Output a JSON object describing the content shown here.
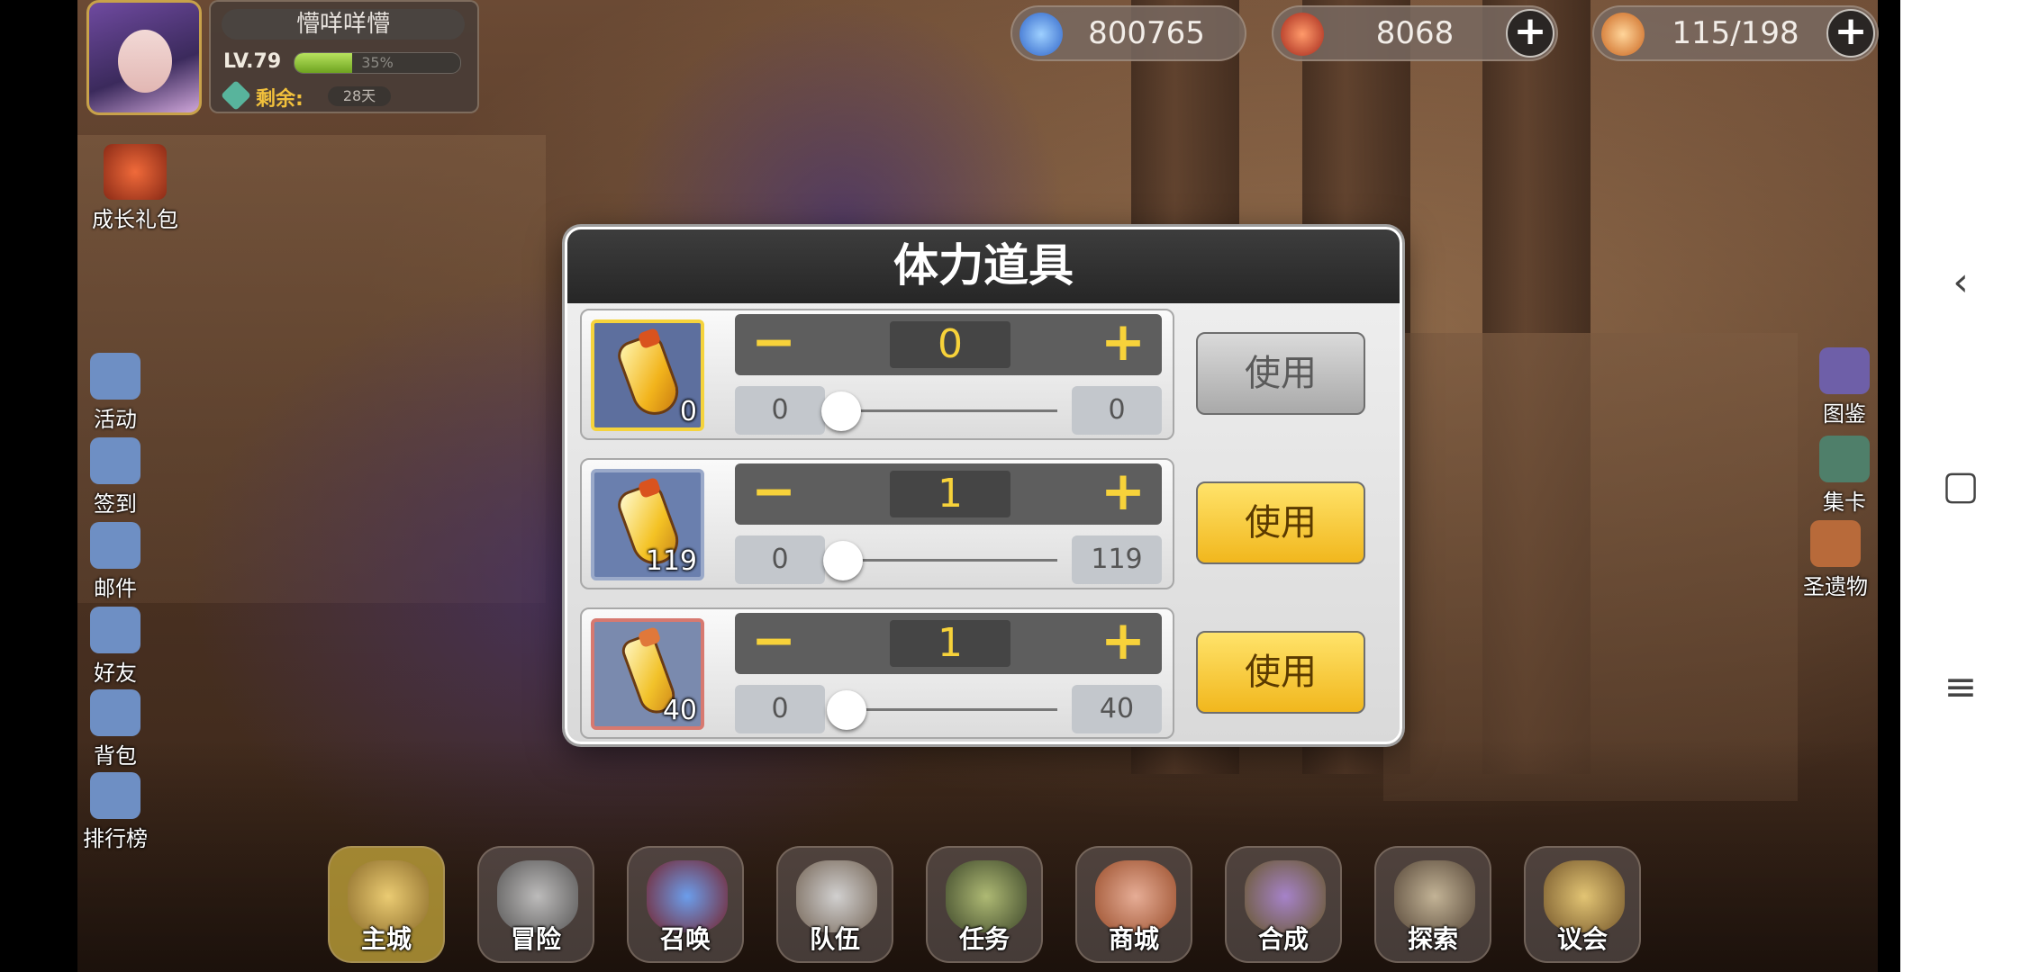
{
  "player": {
    "name": "懵咩咩懵",
    "level_label": "LV.79",
    "xp_percent_text": "35%",
    "xp_fraction": 0.35,
    "remaining_label": "剩余:",
    "remaining_days": "28天"
  },
  "currencies": [
    {
      "name": "crystal",
      "value": "800765",
      "has_plus": false,
      "color": "#3f7fe0"
    },
    {
      "name": "gem",
      "value": "8068",
      "has_plus": true,
      "color": "#c8442c"
    },
    {
      "name": "stamina",
      "value": "115/198",
      "has_plus": true,
      "color": "#d2782c"
    }
  ],
  "left_menu": {
    "gift_pack": "成长礼包",
    "items": [
      "活动",
      "签到",
      "邮件",
      "好友",
      "背包",
      "排行榜"
    ]
  },
  "right_menu": [
    "图鉴",
    "集卡",
    "圣遗物"
  ],
  "bottom_nav": [
    "主城",
    "冒险",
    "召唤",
    "队伍",
    "任务",
    "商城",
    "合成",
    "探索",
    "议会"
  ],
  "dialog": {
    "title": "体力道具",
    "rows": [
      {
        "count": "0",
        "value": "0",
        "min": "0",
        "max": "0",
        "slider_fraction": 0.0,
        "button": "使用",
        "enabled": false,
        "frame": "gold"
      },
      {
        "count": "119",
        "value": "1",
        "min": "0",
        "max": "119",
        "slider_fraction": 0.0084,
        "button": "使用",
        "enabled": true,
        "frame": "blue"
      },
      {
        "count": "40",
        "value": "1",
        "min": "0",
        "max": "40",
        "slider_fraction": 0.025,
        "button": "使用",
        "enabled": true,
        "frame": "red"
      }
    ],
    "minus_symbol": "−",
    "plus_symbol": "+"
  },
  "android": {
    "back": "‹",
    "home": "▢",
    "menu": "≡"
  }
}
